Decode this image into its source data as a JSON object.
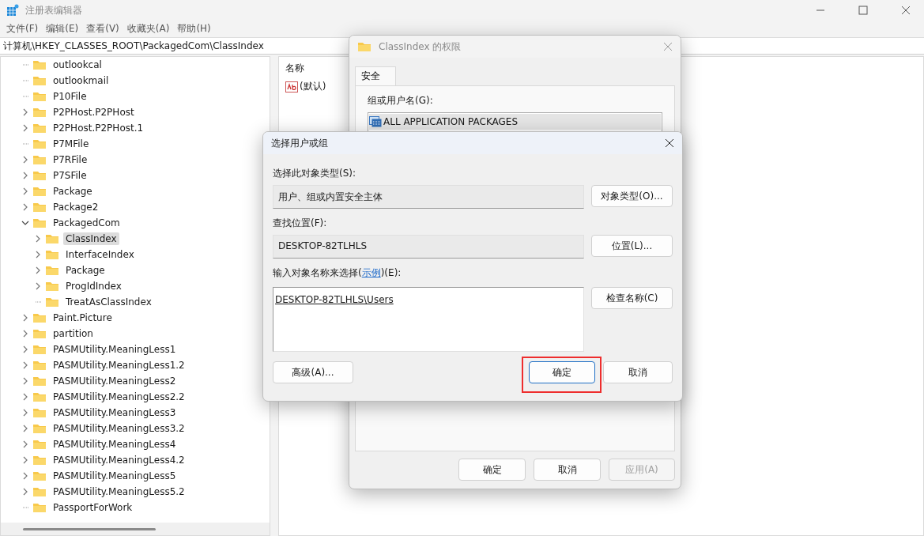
{
  "window": {
    "title": "注册表编辑器"
  },
  "menu": [
    "文件(F)",
    "编辑(E)",
    "查看(V)",
    "收藏夹(A)",
    "帮助(H)"
  ],
  "address": "计算机\\HKEY_CLASSES_ROOT\\PackagedCom\\ClassIndex",
  "tree": [
    {
      "label": "outlookcal",
      "expandable": false,
      "expanded": false,
      "selected": false
    },
    {
      "label": "outlookmail",
      "expandable": false,
      "expanded": false,
      "selected": false
    },
    {
      "label": "P10File",
      "expandable": false,
      "expanded": false,
      "selected": false
    },
    {
      "label": "P2PHost.P2PHost",
      "expandable": true,
      "expanded": false,
      "selected": false
    },
    {
      "label": "P2PHost.P2PHost.1",
      "expandable": true,
      "expanded": false,
      "selected": false
    },
    {
      "label": "P7MFile",
      "expandable": false,
      "expanded": false,
      "selected": false
    },
    {
      "label": "P7RFile",
      "expandable": true,
      "expanded": false,
      "selected": false
    },
    {
      "label": "P7SFile",
      "expandable": true,
      "expanded": false,
      "selected": false
    },
    {
      "label": "Package",
      "expandable": true,
      "expanded": false,
      "selected": false
    },
    {
      "label": "Package2",
      "expandable": true,
      "expanded": false,
      "selected": false
    },
    {
      "label": "PackagedCom",
      "expandable": true,
      "expanded": true,
      "selected": false,
      "children": [
        {
          "label": "ClassIndex",
          "expandable": true,
          "expanded": false,
          "selected": true
        },
        {
          "label": "InterfaceIndex",
          "expandable": true,
          "expanded": false,
          "selected": false
        },
        {
          "label": "Package",
          "expandable": true,
          "expanded": false,
          "selected": false
        },
        {
          "label": "ProgIdIndex",
          "expandable": true,
          "expanded": false,
          "selected": false
        },
        {
          "label": "TreatAsClassIndex",
          "expandable": false,
          "expanded": false,
          "selected": false
        }
      ]
    },
    {
      "label": "Paint.Picture",
      "expandable": true,
      "expanded": false,
      "selected": false
    },
    {
      "label": "partition",
      "expandable": true,
      "expanded": false,
      "selected": false
    },
    {
      "label": "PASMUtility.MeaningLess1",
      "expandable": true,
      "expanded": false,
      "selected": false
    },
    {
      "label": "PASMUtility.MeaningLess1.2",
      "expandable": true,
      "expanded": false,
      "selected": false
    },
    {
      "label": "PASMUtility.MeaningLess2",
      "expandable": true,
      "expanded": false,
      "selected": false
    },
    {
      "label": "PASMUtility.MeaningLess2.2",
      "expandable": true,
      "expanded": false,
      "selected": false
    },
    {
      "label": "PASMUtility.MeaningLess3",
      "expandable": true,
      "expanded": false,
      "selected": false
    },
    {
      "label": "PASMUtility.MeaningLess3.2",
      "expandable": true,
      "expanded": false,
      "selected": false
    },
    {
      "label": "PASMUtility.MeaningLess4",
      "expandable": true,
      "expanded": false,
      "selected": false
    },
    {
      "label": "PASMUtility.MeaningLess4.2",
      "expandable": true,
      "expanded": false,
      "selected": false
    },
    {
      "label": "PASMUtility.MeaningLess5",
      "expandable": true,
      "expanded": false,
      "selected": false
    },
    {
      "label": "PASMUtility.MeaningLess5.2",
      "expandable": true,
      "expanded": false,
      "selected": false
    },
    {
      "label": "PassportForWork",
      "expandable": false,
      "expanded": false,
      "selected": false
    }
  ],
  "values": {
    "columns": [
      "名称"
    ],
    "rows": [
      "(默认)"
    ]
  },
  "permissions_dialog": {
    "title": "ClassIndex 的权限",
    "tabs": [
      {
        "label": "安全",
        "selected": true
      }
    ],
    "group_label": "组或用户名(G):",
    "principals": [
      {
        "name": "ALL APPLICATION PACKAGES",
        "selected": true
      }
    ],
    "buttons": [
      {
        "label": "确定",
        "disabled": false
      },
      {
        "label": "取消",
        "disabled": false
      },
      {
        "label": "应用(A)",
        "disabled": true
      }
    ]
  },
  "select_dialog": {
    "title": "选择用户或组",
    "object_type_label": "选择此对象类型(S):",
    "object_type": "用户、组或内置安全主体",
    "object_type_button": "对象类型(O)...",
    "location_label": "查找位置(F):",
    "location": "DESKTOP-82TLHLS",
    "location_button": "位置(L)...",
    "names_label_before": "输入对象名称来选择(",
    "names_label_link": "示例",
    "names_label_after": ")(E):",
    "names_value": "DESKTOP-82TLHLS\\Users",
    "check_button": "检查名称(C)",
    "advanced_button": "高级(A)...",
    "ok_button": {
      "label": "确定",
      "highlighted": true
    },
    "cancel_button": "取消"
  }
}
